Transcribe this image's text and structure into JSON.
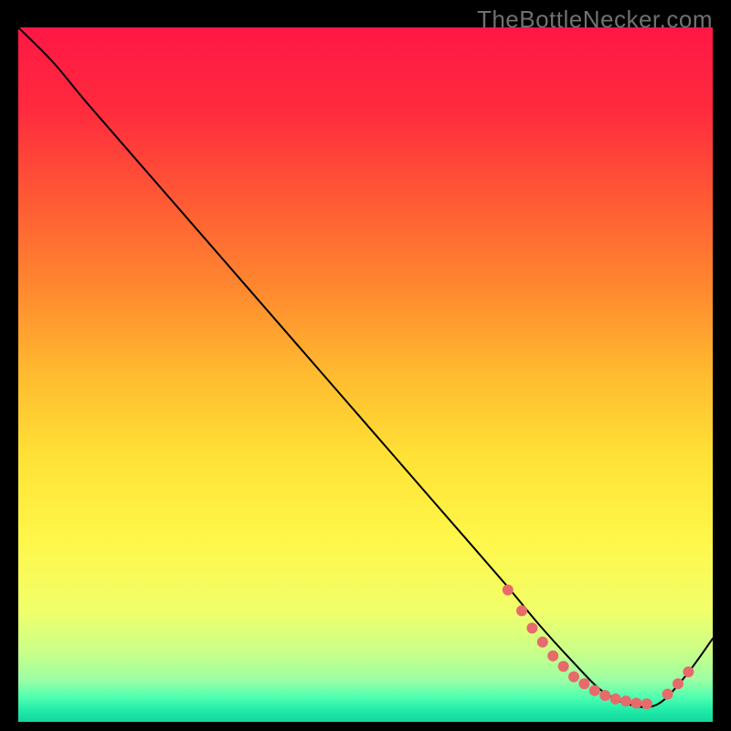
{
  "watermark": "TheBottleNecker.com",
  "chart_data": {
    "type": "line",
    "title": "",
    "xlabel": "",
    "ylabel": "",
    "xlim": [
      0,
      100
    ],
    "ylim": [
      0,
      100
    ],
    "grid": false,
    "background_gradient": {
      "stops": [
        {
          "offset": 0.0,
          "color": "#ff1745"
        },
        {
          "offset": 0.12,
          "color": "#ff2b3e"
        },
        {
          "offset": 0.25,
          "color": "#ff5a34"
        },
        {
          "offset": 0.38,
          "color": "#ff8a2f"
        },
        {
          "offset": 0.5,
          "color": "#ffbb2f"
        },
        {
          "offset": 0.62,
          "color": "#ffe236"
        },
        {
          "offset": 0.74,
          "color": "#fff74a"
        },
        {
          "offset": 0.84,
          "color": "#f1ff6a"
        },
        {
          "offset": 0.9,
          "color": "#c9ff8a"
        },
        {
          "offset": 0.94,
          "color": "#9bffa4"
        },
        {
          "offset": 0.965,
          "color": "#4dffb0"
        },
        {
          "offset": 0.985,
          "color": "#1de9a8"
        },
        {
          "offset": 1.0,
          "color": "#14d79e"
        }
      ]
    },
    "series": [
      {
        "name": "curve",
        "color": "#000000",
        "stroke_width": 2,
        "x": [
          0,
          5,
          10,
          20,
          30,
          40,
          50,
          60,
          70,
          75,
          80,
          84,
          88,
          92,
          96,
          100
        ],
        "y": [
          100,
          95,
          89,
          77.5,
          66,
          54.5,
          43,
          31.5,
          20,
          14,
          8.5,
          4.5,
          2.5,
          2.5,
          6.5,
          12
        ]
      }
    ],
    "markers": {
      "name": "scatter",
      "color": "#e66b6a",
      "radius": 6,
      "x": [
        70.5,
        72.5,
        74,
        75.5,
        77,
        78.5,
        80,
        81.5,
        83,
        84.5,
        86,
        87.5,
        89,
        90.5,
        93.5,
        95,
        96.5
      ],
      "y": [
        19,
        16,
        13.5,
        11.5,
        9.5,
        8,
        6.5,
        5.5,
        4.5,
        3.8,
        3.3,
        3.0,
        2.7,
        2.6,
        4.0,
        5.5,
        7.2
      ]
    }
  }
}
